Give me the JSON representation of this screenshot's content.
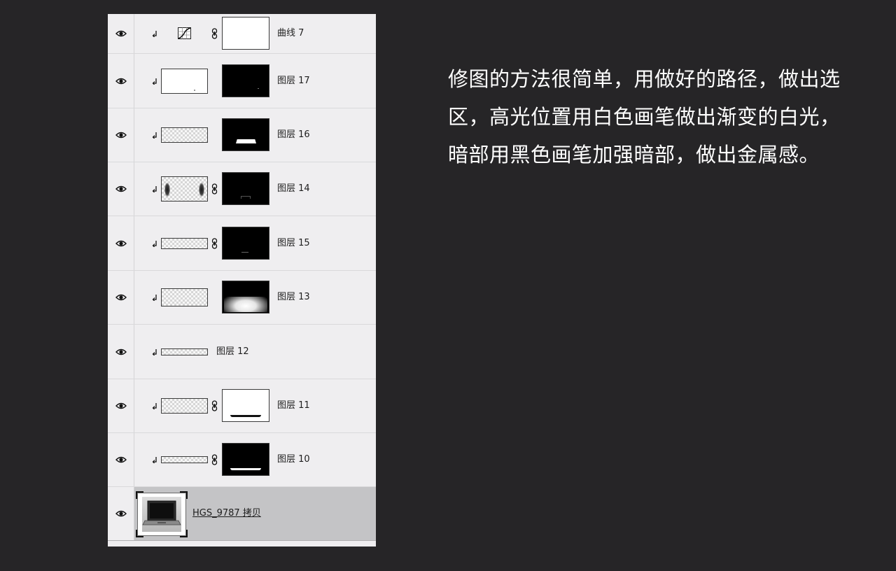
{
  "layers_panel": {
    "layers": [
      {
        "name": "曲线 7",
        "type": "curves"
      },
      {
        "name": "图层 17",
        "type": "masked"
      },
      {
        "name": "图层 16",
        "type": "masked"
      },
      {
        "name": "图层 14",
        "type": "masked"
      },
      {
        "name": "图层 15",
        "type": "masked"
      },
      {
        "name": "图层 13",
        "type": "masked"
      },
      {
        "name": "图层 12",
        "type": "plain"
      },
      {
        "name": "图层 11",
        "type": "masked"
      },
      {
        "name": "图层 10",
        "type": "masked"
      },
      {
        "name": "HGS_9787 拷贝",
        "type": "smart-object",
        "selected": true
      }
    ]
  },
  "description": {
    "text": "修图的方法很简单，用做好的路径，做出选区，高光位置用白色画笔做出渐变的白光，暗部用黑色画笔加强暗部，做出金属感。"
  },
  "colors": {
    "background": "#262527",
    "panel": "#efeef0",
    "selected_row": "#c4c4c6",
    "text_light": "#ffffff",
    "text_dark": "#1e1e1e"
  }
}
